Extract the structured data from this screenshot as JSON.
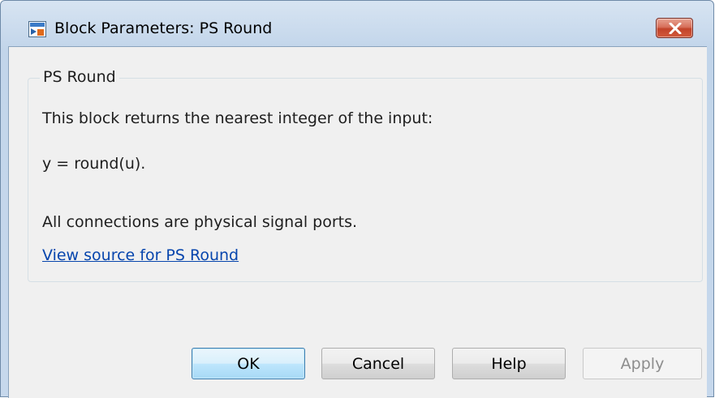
{
  "window": {
    "title": "Block Parameters: PS Round",
    "close_icon": "close-icon"
  },
  "group": {
    "title": "PS Round",
    "description": "This block returns the nearest integer of the input:",
    "equation": "y = round(u).",
    "note": "All connections are physical signal ports.",
    "link": "View source for PS Round"
  },
  "buttons": {
    "ok": "OK",
    "cancel": "Cancel",
    "help": "Help",
    "apply": "Apply"
  },
  "colors": {
    "link": "#0645ad",
    "close_button": "#c2432a",
    "default_button_border": "#3c7fb1"
  }
}
